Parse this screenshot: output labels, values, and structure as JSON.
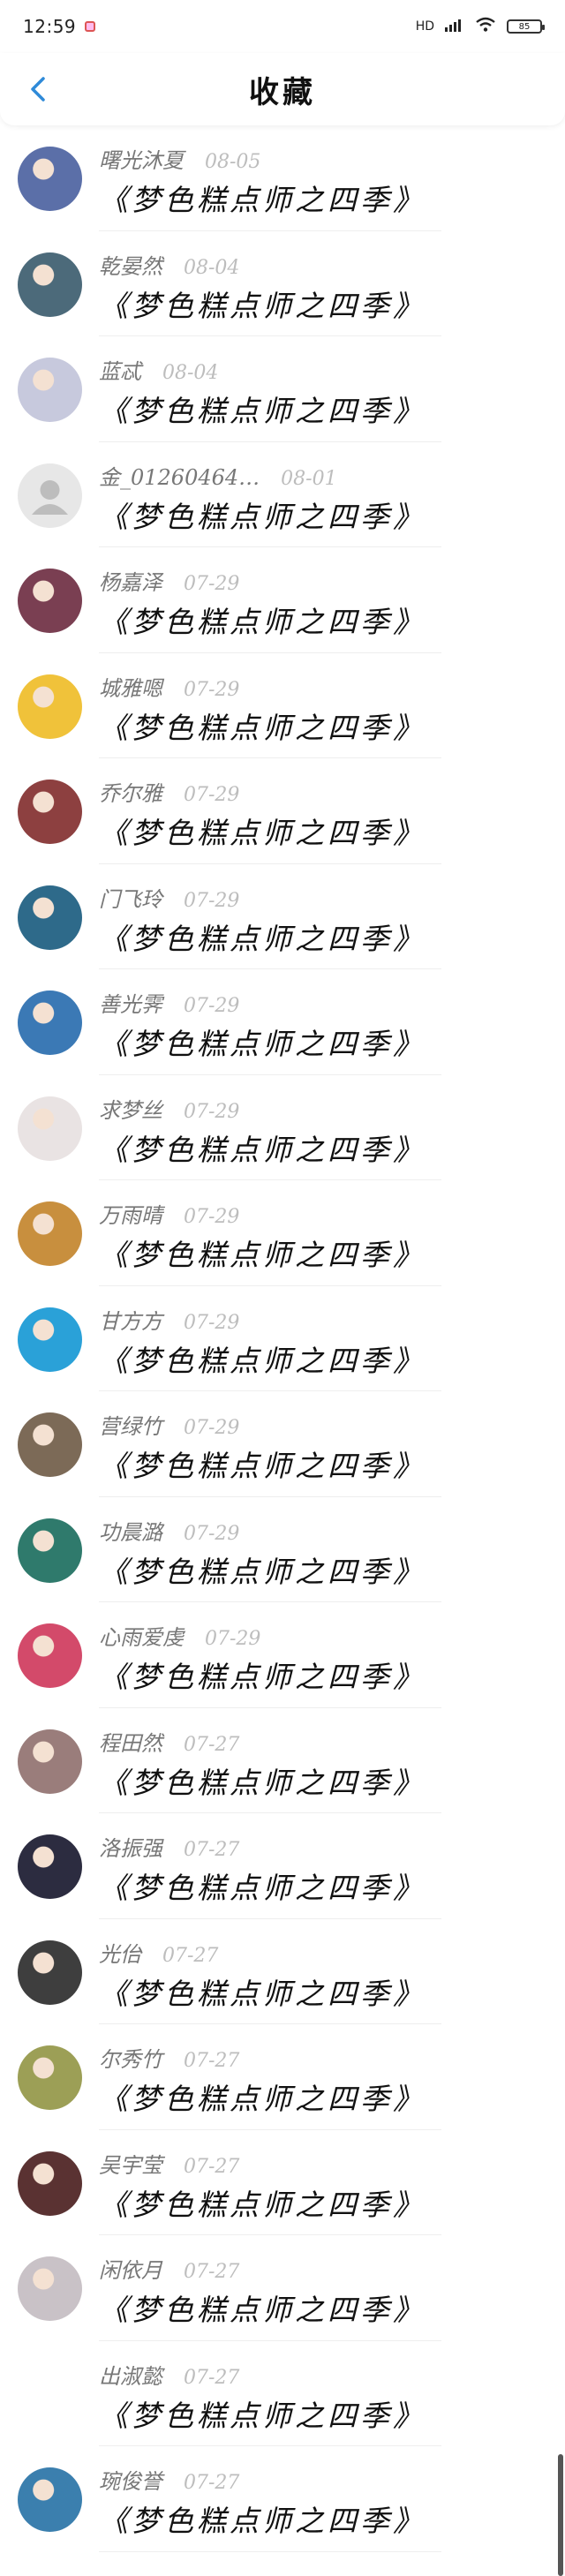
{
  "status": {
    "time": "12:59",
    "network": "HD",
    "battery": "85"
  },
  "header": {
    "title": "收藏"
  },
  "colors": {
    "accent": "#2f8ad8",
    "name": "#777777",
    "date": "#bdbdbd"
  },
  "items": [
    {
      "name": "曙光沐夏",
      "date": "08-05",
      "title": "《梦色糕点师之四季》",
      "avatar": "#5b6fa8"
    },
    {
      "name": "乾晏然",
      "date": "08-04",
      "title": "《梦色糕点师之四季》",
      "avatar": "#4c6a7a"
    },
    {
      "name": "蓝忒",
      "date": "08-04",
      "title": "《梦色糕点师之四季》",
      "avatar": "#c7c9dd"
    },
    {
      "name": "金_01260464…",
      "date": "08-01",
      "title": "《梦色糕点师之四季》",
      "avatar": "default"
    },
    {
      "name": "杨嘉泽",
      "date": "07-29",
      "title": "《梦色糕点师之四季》",
      "avatar": "#7a3f52"
    },
    {
      "name": "城雅嗯",
      "date": "07-29",
      "title": "《梦色糕点师之四季》",
      "avatar": "#f0c23a"
    },
    {
      "name": "乔尔雅",
      "date": "07-29",
      "title": "《梦色糕点师之四季》",
      "avatar": "#8d4040"
    },
    {
      "name": "门飞玲",
      "date": "07-29",
      "title": "《梦色糕点师之四季》",
      "avatar": "#2e6a8a"
    },
    {
      "name": "善光霁",
      "date": "07-29",
      "title": "《梦色糕点师之四季》",
      "avatar": "#3b79b5"
    },
    {
      "name": "求梦丝",
      "date": "07-29",
      "title": "《梦色糕点师之四季》",
      "avatar": "#e9e3e3"
    },
    {
      "name": "万雨晴",
      "date": "07-29",
      "title": "《梦色糕点师之四季》",
      "avatar": "#c88f3e"
    },
    {
      "name": "甘方方",
      "date": "07-29",
      "title": "《梦色糕点师之四季》",
      "avatar": "#2aa1d8"
    },
    {
      "name": "营绿竹",
      "date": "07-29",
      "title": "《梦色糕点师之四季》",
      "avatar": "#7c6a57"
    },
    {
      "name": "功晨潞",
      "date": "07-29",
      "title": "《梦色糕点师之四季》",
      "avatar": "#2f7a6c"
    },
    {
      "name": "心雨爱虔",
      "date": "07-29",
      "title": "《梦色糕点师之四季》",
      "avatar": "#d34a6a"
    },
    {
      "name": "程田然",
      "date": "07-27",
      "title": "《梦色糕点师之四季》",
      "avatar": "#9a7d7b"
    },
    {
      "name": "洛振强",
      "date": "07-27",
      "title": "《梦色糕点师之四季》",
      "avatar": "#2c2c40"
    },
    {
      "name": "光佁",
      "date": "07-27",
      "title": "《梦色糕点师之四季》",
      "avatar": "#3e3e3e"
    },
    {
      "name": "尔秀竹",
      "date": "07-27",
      "title": "《梦色糕点师之四季》",
      "avatar": "#9c9f56"
    },
    {
      "name": "吴宇莹",
      "date": "07-27",
      "title": "《梦色糕点师之四季》",
      "avatar": "#5a3232"
    },
    {
      "name": "闲依月",
      "date": "07-27",
      "title": "《梦色糕点师之四季》",
      "avatar": "#c9c2c7"
    },
    {
      "name": "出淑懿",
      "date": "07-27",
      "title": "《梦色糕点师之四季》",
      "avatar": "none"
    },
    {
      "name": "琬俊誉",
      "date": "07-27",
      "title": "《梦色糕点师之四季》",
      "avatar": "#3b7fae"
    }
  ]
}
